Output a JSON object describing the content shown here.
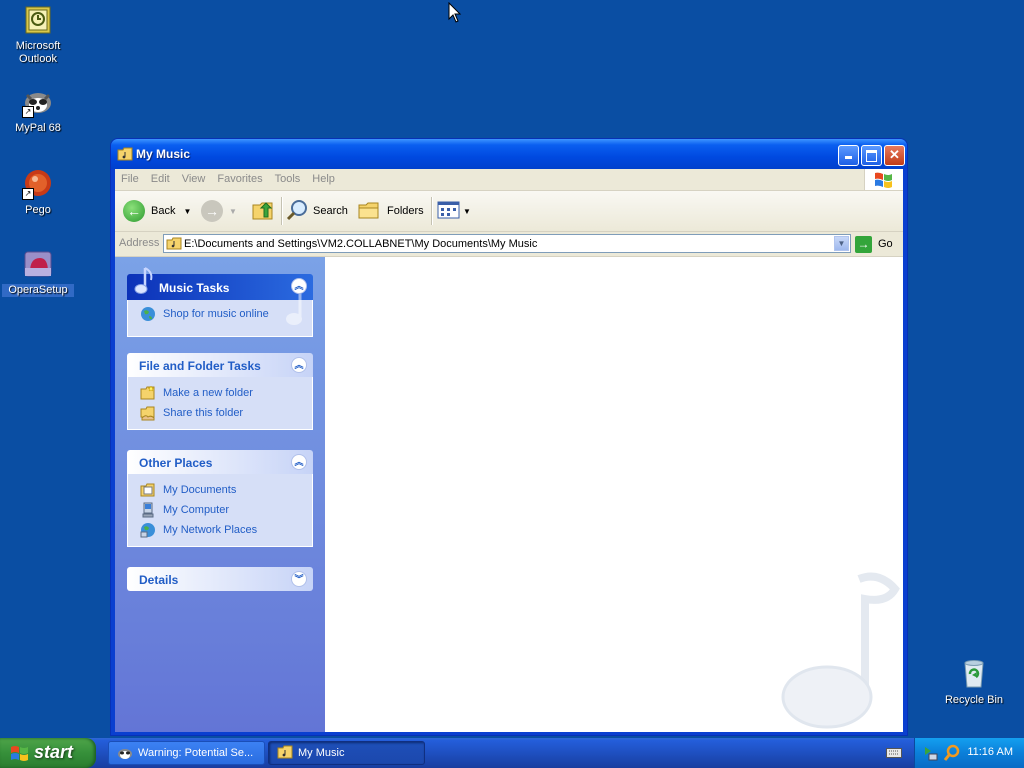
{
  "desktop": {
    "icons": [
      {
        "label": "Microsoft\nOutlook",
        "line1": "Microsoft",
        "line2": "Outlook"
      },
      {
        "label": "MyPal 68"
      },
      {
        "label": "Pego"
      },
      {
        "label": "OperaSetup"
      },
      {
        "label": "Recycle Bin"
      }
    ]
  },
  "window": {
    "title": "My Music",
    "menu": [
      "File",
      "Edit",
      "View",
      "Favorites",
      "Tools",
      "Help"
    ],
    "toolbar": {
      "back": "Back",
      "search": "Search",
      "folders": "Folders"
    },
    "address": {
      "label": "Address",
      "value": "E:\\Documents and Settings\\VM2.COLLABNET\\My Documents\\My Music",
      "go": "Go"
    },
    "panels": {
      "music_tasks": {
        "title": "Music Tasks",
        "items": [
          "Shop for music online"
        ]
      },
      "file_folder_tasks": {
        "title": "File and Folder Tasks",
        "items": [
          "Make a new folder",
          "Share this folder"
        ]
      },
      "other_places": {
        "title": "Other Places",
        "items": [
          "My Documents",
          "My Computer",
          "My Network Places"
        ]
      },
      "details": {
        "title": "Details"
      }
    }
  },
  "taskbar": {
    "start": "start",
    "items": [
      {
        "label": "Warning: Potential Se..."
      },
      {
        "label": "My Music"
      }
    ],
    "clock": "11:16 AM"
  },
  "colors": {
    "desktop": "#0a4ea3",
    "taskpane_link": "#215dc6",
    "titlebar": "#0049e0"
  }
}
